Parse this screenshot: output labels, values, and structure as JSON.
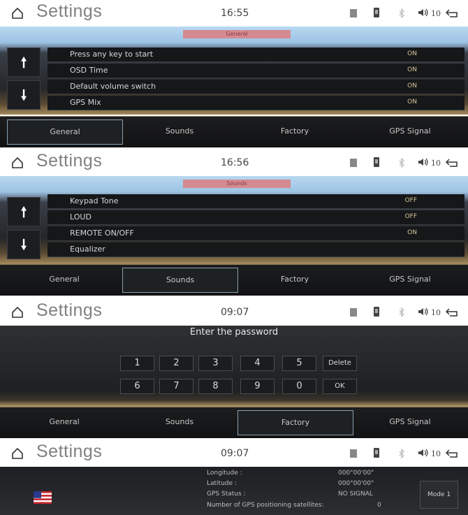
{
  "common": {
    "title": "Settings",
    "volume": "10",
    "colors": {
      "section_header": "#d48a90",
      "value_text": "#d9c89a",
      "active_tab_border": "#8c9fae"
    },
    "icons": [
      "home-icon",
      "document-icon",
      "phone-icon",
      "bluetooth-icon",
      "speaker-icon",
      "back-icon",
      "arrow-up-icon",
      "arrow-down-icon",
      "flag-icon"
    ]
  },
  "tabs": [
    "General",
    "Sounds",
    "Factory",
    "GPS Signal"
  ],
  "panel1": {
    "time": "16:55",
    "section": "General",
    "active_tab": "General",
    "rows": [
      {
        "label": "Press any key to start",
        "value": "ON"
      },
      {
        "label": "OSD Time",
        "value": "ON"
      },
      {
        "label": "Default volume switch",
        "value": "ON"
      },
      {
        "label": "GPS Mix",
        "value": "ON"
      }
    ]
  },
  "panel2": {
    "time": "16:56",
    "section": "Sounds",
    "active_tab": "Sounds",
    "rows": [
      {
        "label": "Keypad Tone",
        "value": "OFF"
      },
      {
        "label": "LOUD",
        "value": "OFF"
      },
      {
        "label": "REMOTE ON/OFF",
        "value": "ON"
      },
      {
        "label": "Equalizer",
        "value": ""
      }
    ]
  },
  "panel3": {
    "time": "09:07",
    "prompt": "Enter the password",
    "active_tab": "Factory",
    "keys_row1": [
      "1",
      "2",
      "3",
      "4",
      "5",
      "Delete"
    ],
    "keys_row2": [
      "6",
      "7",
      "8",
      "9",
      "0",
      "OK"
    ]
  },
  "panel4": {
    "time": "09:07",
    "fields": [
      {
        "label": "Longitude :",
        "value": "000°00'00\""
      },
      {
        "label": "Latitude :",
        "value": "000°00'00\""
      },
      {
        "label": "GPS Status :",
        "value": "NO SIGNAL"
      },
      {
        "label": "Number of GPS positioning satellites:",
        "value": "0"
      }
    ],
    "mode_button": "Mode 1"
  }
}
